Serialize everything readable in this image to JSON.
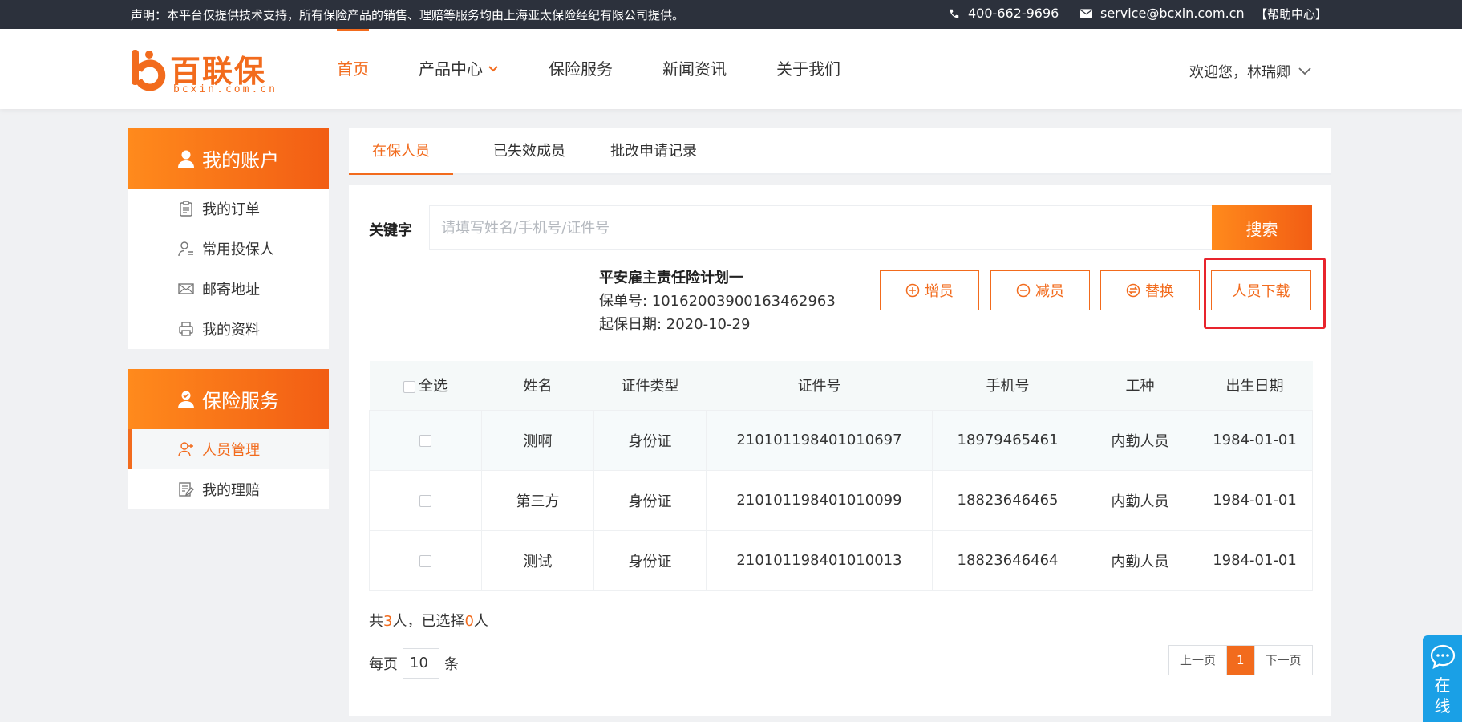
{
  "topbar": {
    "notice": "声明：本平台仅提供技术支持，所有保险产品的销售、理赔等服务均由上海亚太保险经纪有限公司提供。",
    "phone": "400-662-9696",
    "email": "service@bcxin.com.cn",
    "help": "【帮助中心】"
  },
  "logo": {
    "name": "百联保",
    "url": "bcxin.com.cn"
  },
  "nav": {
    "home": "首页",
    "products": "产品中心",
    "service": "保险服务",
    "news": "新闻资讯",
    "about": "关于我们"
  },
  "user": {
    "welcome": "欢迎您，林瑞卿"
  },
  "sidebar": {
    "account": {
      "title": "我的账户",
      "items": [
        "我的订单",
        "常用投保人",
        "邮寄地址",
        "我的资料"
      ]
    },
    "insurance": {
      "title": "保险服务",
      "items": [
        "人员管理",
        "我的理赔"
      ]
    }
  },
  "tabs": [
    "在保人员",
    "已失效成员",
    "批改申请记录"
  ],
  "search": {
    "label": "关键字",
    "placeholder": "请填写姓名/手机号/证件号",
    "button": "搜索"
  },
  "plan": {
    "name": "平安雇主责任险计划一",
    "policy_no": "保单号: 10162003900163462963",
    "start_date": "起保日期: 2020-10-29"
  },
  "actions": {
    "add": "增员",
    "remove": "减员",
    "replace": "替换",
    "download": "人员下载"
  },
  "table": {
    "select_all": "全选",
    "columns": [
      "姓名",
      "证件类型",
      "证件号",
      "手机号",
      "工种",
      "出生日期"
    ],
    "rows": [
      [
        "测啊",
        "身份证",
        "210101198401010697",
        "18979465461",
        "内勤人员",
        "1984-01-01"
      ],
      [
        "第三方",
        "身份证",
        "210101198401010099",
        "18823646465",
        "内勤人员",
        "1984-01-01"
      ],
      [
        "测试",
        "身份证",
        "210101198401010013",
        "18823646464",
        "内勤人员",
        "1984-01-01"
      ]
    ]
  },
  "summary": {
    "prefix": "共",
    "total": "3",
    "mid": "人，已选择",
    "selected": "0",
    "suffix": "人"
  },
  "pagination": {
    "per_page_label": "每页",
    "per_page": "10",
    "unit": "条",
    "prev": "上一页",
    "current": "1",
    "next": "下一页"
  },
  "online": {
    "label": "在线"
  },
  "colors": {
    "accent": "#f26b1d",
    "topbar": "#2c313c",
    "highlight": "#e8242d",
    "chat": "#1aa0e6"
  }
}
